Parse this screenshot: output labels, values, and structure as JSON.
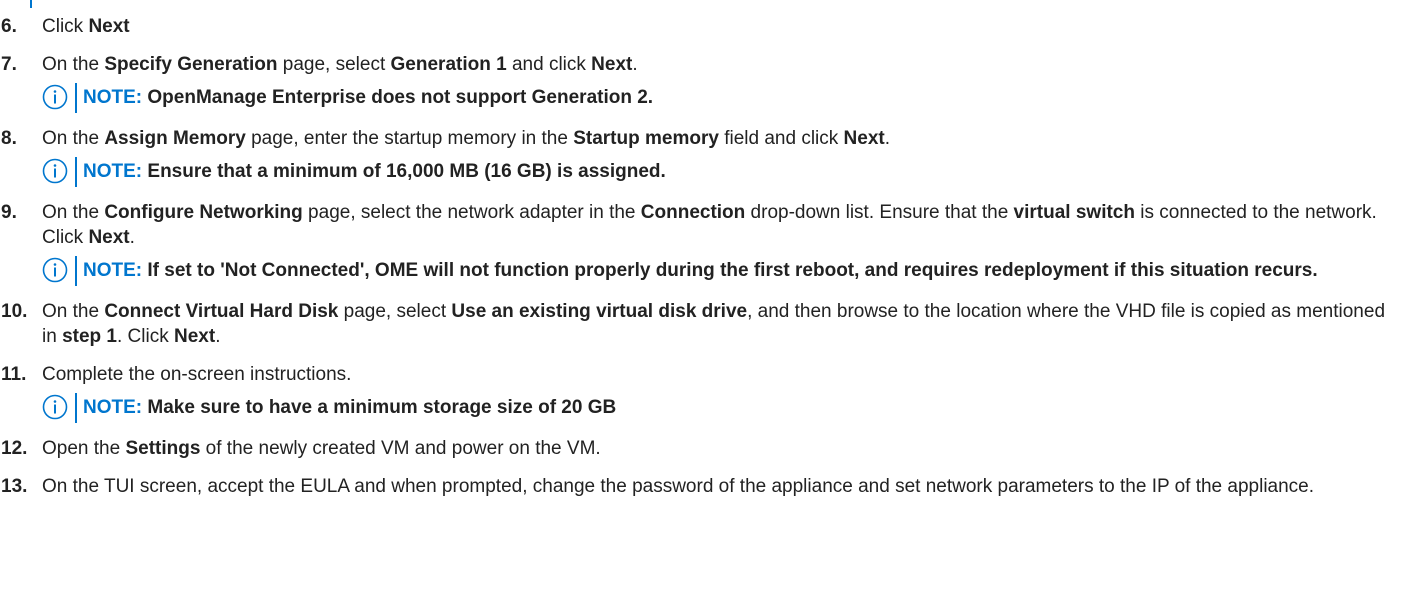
{
  "steps": [
    {
      "num": "6.",
      "parts": [
        [
          "Click ",
          false
        ],
        [
          "Next",
          true
        ]
      ]
    },
    {
      "num": "7.",
      "parts": [
        [
          "On the ",
          false
        ],
        [
          "Specify Generation",
          true
        ],
        [
          " page, select ",
          false
        ],
        [
          "Generation 1",
          true
        ],
        [
          " and click ",
          false
        ],
        [
          "Next",
          true
        ],
        [
          ".",
          false
        ]
      ],
      "note": "OpenManage Enterprise does not support Generation 2."
    },
    {
      "num": "8.",
      "parts": [
        [
          "On the ",
          false
        ],
        [
          "Assign Memory",
          true
        ],
        [
          " page, enter the startup memory in the ",
          false
        ],
        [
          "Startup memory",
          true
        ],
        [
          " field and click ",
          false
        ],
        [
          "Next",
          true
        ],
        [
          ".",
          false
        ]
      ],
      "note": "Ensure that a minimum of 16,000 MB (16 GB) is assigned."
    },
    {
      "num": "9.",
      "parts": [
        [
          "On the ",
          false
        ],
        [
          "Configure Networking",
          true
        ],
        [
          " page, select the network adapter in the ",
          false
        ],
        [
          "Connection",
          true
        ],
        [
          " drop-down list. Ensure that the ",
          false
        ],
        [
          "virtual switch",
          true
        ],
        [
          " is connected to the network. Click ",
          false
        ],
        [
          "Next",
          true
        ],
        [
          ".",
          false
        ]
      ],
      "note": "If set to 'Not Connected', OME will not function properly during the first reboot, and requires redeployment if this situation recurs."
    },
    {
      "num": "10.",
      "parts": [
        [
          "On the ",
          false
        ],
        [
          "Connect Virtual Hard Disk",
          true
        ],
        [
          " page, select ",
          false
        ],
        [
          "Use an existing virtual disk drive",
          true
        ],
        [
          ", and then browse to the location where the VHD file is copied as mentioned in ",
          false
        ],
        [
          "step 1",
          true
        ],
        [
          ". Click ",
          false
        ],
        [
          "Next",
          true
        ],
        [
          ".",
          false
        ]
      ]
    },
    {
      "num": "11.",
      "parts": [
        [
          "Complete the on-screen instructions.",
          false
        ]
      ],
      "note": "Make sure to have a minimum storage size of 20 GB"
    },
    {
      "num": "12.",
      "parts": [
        [
          "Open the ",
          false
        ],
        [
          "Settings",
          true
        ],
        [
          " of the newly created VM and power on the VM.",
          false
        ]
      ]
    },
    {
      "num": "13.",
      "parts": [
        [
          "On the TUI screen, accept the EULA and when prompted, change the password of the appliance and set network parameters to the IP of the appliance.",
          false
        ]
      ]
    }
  ],
  "note_label": "NOTE:",
  "icons": {
    "note": "info-icon"
  },
  "colors": {
    "accent": "#0076ce",
    "text": "#222222"
  }
}
